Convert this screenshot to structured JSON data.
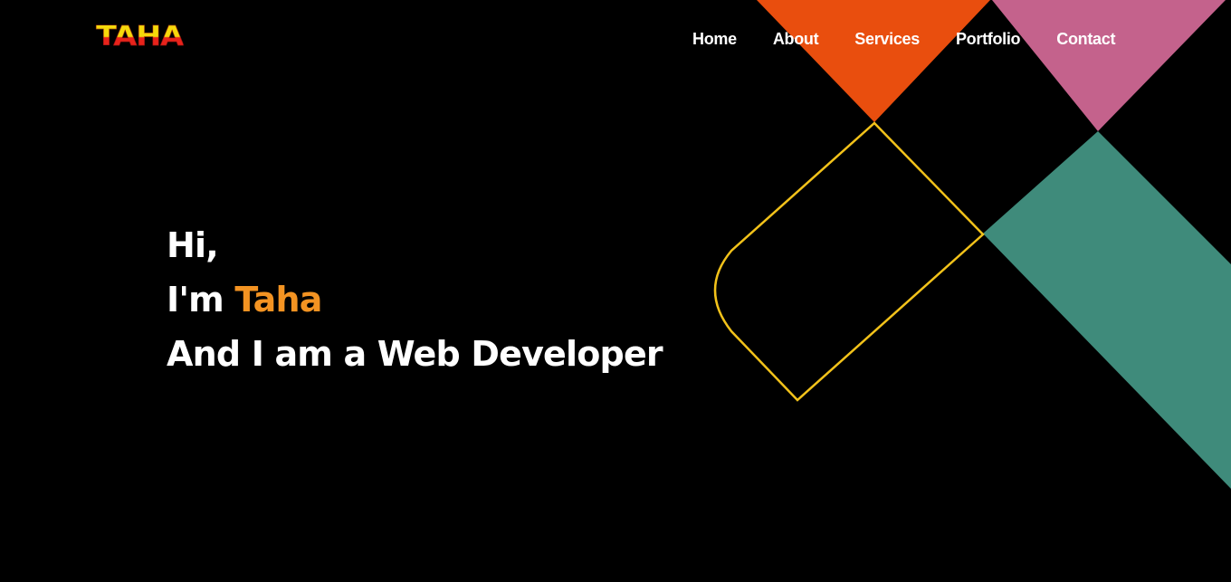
{
  "logo": {
    "text": "TAHA"
  },
  "nav": {
    "items": [
      {
        "label": "Home"
      },
      {
        "label": "About"
      },
      {
        "label": "Services"
      },
      {
        "label": "Portfolio"
      },
      {
        "label": "Contact"
      }
    ]
  },
  "hero": {
    "greeting": "Hi,",
    "intro_prefix": "I'm ",
    "name": "Taha",
    "tagline": "And I am a Web Developer"
  },
  "colors": {
    "background": "#000000",
    "text": "#ffffff",
    "accent_name": "#f39322",
    "orange_shape": "#e94e0e",
    "pink_shape": "#c4628c",
    "teal_shape": "#3f8b7b",
    "outline_shape": "#f2c21a"
  }
}
